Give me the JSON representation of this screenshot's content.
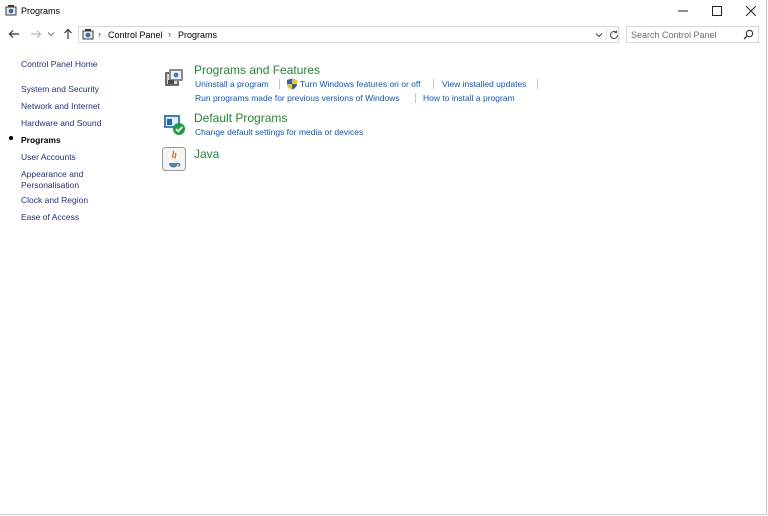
{
  "window": {
    "title": "Programs",
    "controls": {
      "minimize": "minimize",
      "maximize": "maximize",
      "close": "close"
    }
  },
  "address": {
    "breadcrumb": [
      "Control Panel",
      "Programs"
    ],
    "search_placeholder": "Search Control Panel"
  },
  "sidebar": {
    "items": [
      {
        "label": "Control Panel Home",
        "current": false
      },
      {
        "label": "System and Security",
        "current": false
      },
      {
        "label": "Network and Internet",
        "current": false
      },
      {
        "label": "Hardware and Sound",
        "current": false
      },
      {
        "label": "Programs",
        "current": true
      },
      {
        "label": "User Accounts",
        "current": false
      },
      {
        "label": "Appearance and\nPersonalisation",
        "current": false
      },
      {
        "label": "Clock and Region",
        "current": false
      },
      {
        "label": "Ease of Access",
        "current": false
      }
    ]
  },
  "categories": [
    {
      "title": "Programs and Features",
      "icon": "programs-features-icon",
      "links_row1": [
        "Uninstall a program",
        "Turn Windows features on or off",
        "View installed updates"
      ],
      "links_row2": [
        "Run programs made for previous versions of Windows",
        "How to install a program"
      ]
    },
    {
      "title": "Default Programs",
      "icon": "default-programs-icon",
      "links_row1": [
        "Change default settings for media or devices"
      ]
    },
    {
      "title": "Java",
      "icon": "java-icon"
    }
  ],
  "colors": {
    "link": "#0b57d0",
    "category_title": "#1e8c2e",
    "sidebar_link": "#1e3287"
  }
}
